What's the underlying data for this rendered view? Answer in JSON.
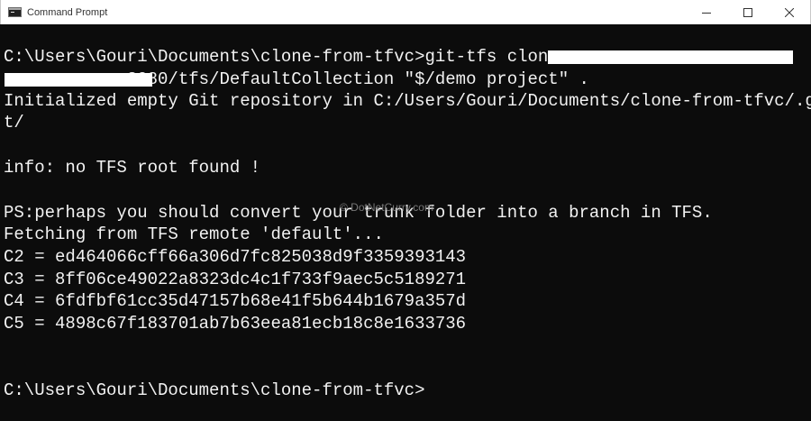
{
  "window": {
    "title": "Command Prompt",
    "icons": {
      "app": "console-icon",
      "minimize": "minimize-icon",
      "maximize": "maximize-icon",
      "close": "close-icon"
    }
  },
  "terminal": {
    "lines": [
      "",
      "C:\\Users\\Gouri\\Documents\\clone-from-tfvc>git-tfs clone",
      "           :8080/tfs/DefaultCollection \"$/demo project\" .",
      "Initialized empty Git repository in C:/Users/Gouri/Documents/clone-from-tfvc/.gi",
      "t/",
      "",
      "info: no TFS root found !",
      "",
      "PS:perhaps you should convert your trunk folder into a branch in TFS.",
      "Fetching from TFS remote 'default'...",
      "C2 = ed464066cff66a306d7fc825038d9f3359393143",
      "C3 = 8ff06ce49022a8323dc4c1f733f9aec5c5189271",
      "C4 = 6fdfbf61cc35d47157b68e41f5b644b1679a357d",
      "C5 = 4898c67f183701ab7b63eea81ecb18c8e1633736",
      "",
      "",
      "C:\\Users\\Gouri\\Documents\\clone-from-tfvc>"
    ]
  },
  "watermark": "© DotNetCurry.com",
  "colors": {
    "background": "#0c0c0c",
    "foreground": "#f2f2f2",
    "titlebar": "#ffffff",
    "redaction": "#ffffff"
  }
}
